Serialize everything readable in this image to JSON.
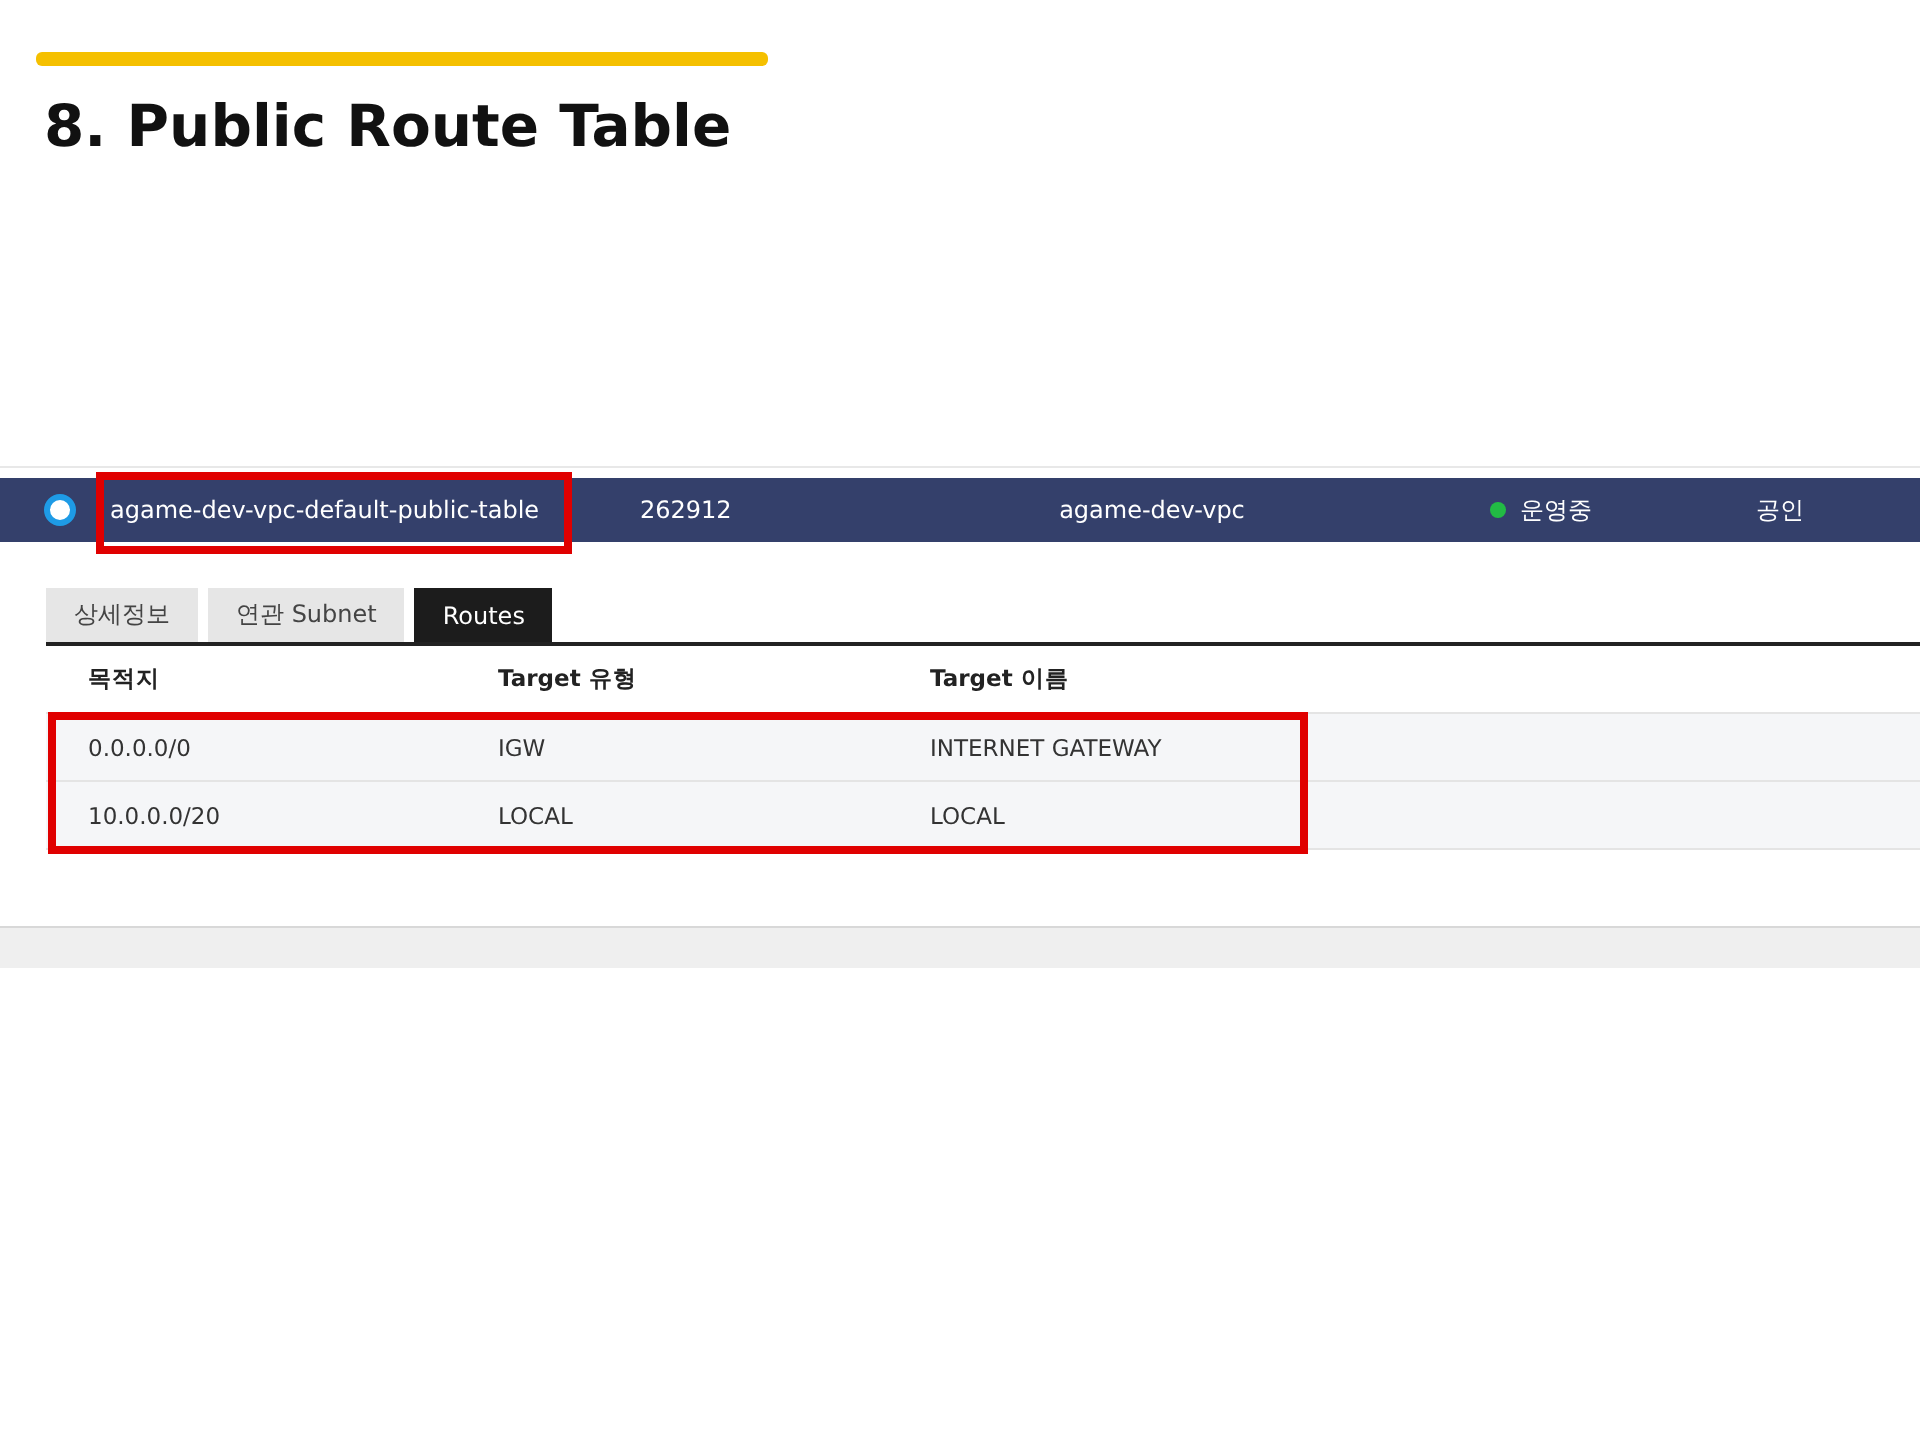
{
  "slide": {
    "title": "8. Public Route Table"
  },
  "route_table": {
    "selected": true,
    "name": "agame-dev-vpc-default-public-table",
    "name_highlighted": true,
    "id": "262912",
    "vpc": "agame-dev-vpc",
    "status": {
      "text": "운영중",
      "color": "#22bb44"
    },
    "type": "공인"
  },
  "tabs": [
    {
      "label": "상세정보",
      "selected": false
    },
    {
      "label": "연관 Subnet",
      "selected": false
    },
    {
      "label": "Routes",
      "selected": true
    }
  ],
  "routes": {
    "columns": [
      "목적지",
      "Target 유형",
      "Target 이름"
    ],
    "rows_highlighted": true,
    "rows": [
      [
        "0.0.0.0/0",
        "IGW",
        "INTERNET GATEWAY"
      ],
      [
        "10.0.0.0/20",
        "LOCAL",
        "LOCAL"
      ]
    ]
  }
}
